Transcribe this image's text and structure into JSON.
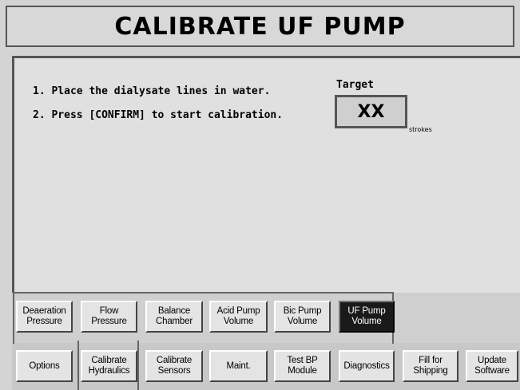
{
  "title": "CALIBRATE UF PUMP",
  "instructions": [
    "1. Place the dialysate lines in water.",
    "2. Press [CONFIRM] to start calibration."
  ],
  "target": {
    "label": "Target",
    "value": "XX",
    "unit": "strokes"
  },
  "sub_tabs": [
    {
      "label": "Deaeration\nPressure"
    },
    {
      "label": "Flow\nPressure"
    },
    {
      "label": "Balance\nChamber"
    },
    {
      "label": "Acid Pump\nVolume"
    },
    {
      "label": "Bic Pump\nVolume"
    },
    {
      "label": "UF Pump\nVolume",
      "active": true
    }
  ],
  "main_tabs": [
    {
      "label": "Options"
    },
    {
      "label": "Calibrate\nHydraulics",
      "selected": true
    },
    {
      "label": "Calibrate\nSensors"
    },
    {
      "label": "Maint."
    },
    {
      "label": "Test BP\nModule"
    },
    {
      "label": "Diagnostics"
    },
    {
      "label": "Fill for\nShipping"
    },
    {
      "label": "Update\nSoftware"
    }
  ]
}
